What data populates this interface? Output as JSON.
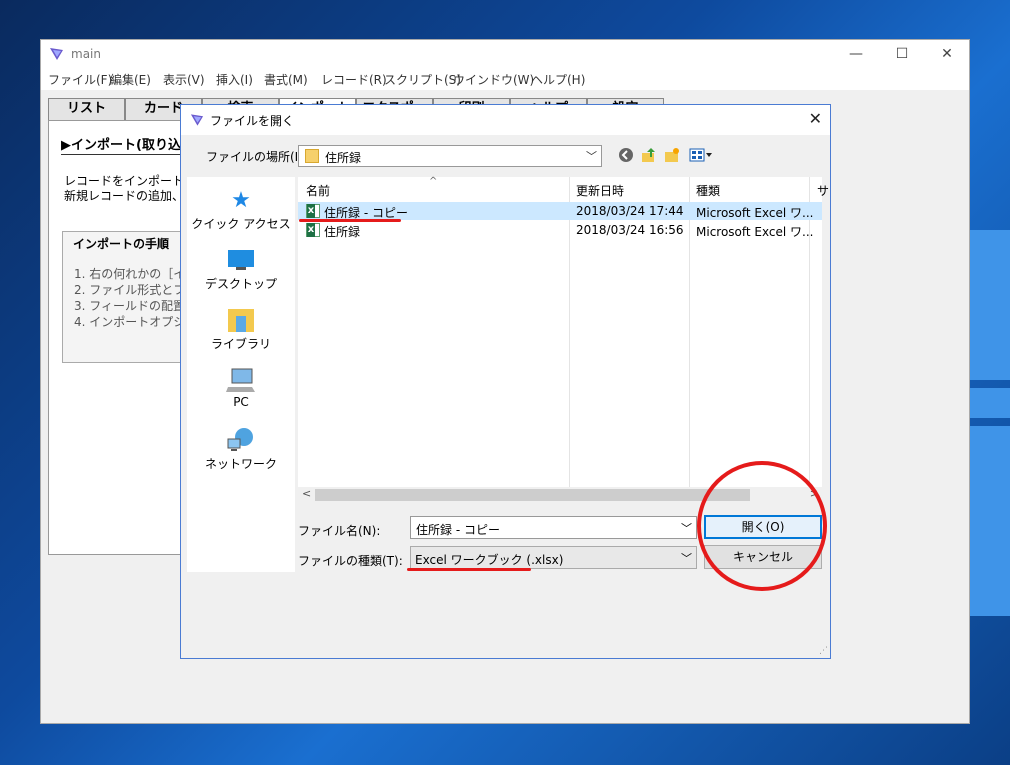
{
  "window": {
    "title": "main",
    "controls": {
      "minimize": "—",
      "maximize": "☐",
      "close": "✕"
    }
  },
  "menubar": [
    "ファイル(F)",
    "編集(E)",
    "表示(V)",
    "挿入(I)",
    "書式(M)",
    "レコード(R)",
    "スクリプト(S)",
    "ウインドウ(W)",
    "ヘルプ(H)"
  ],
  "tabs": [
    "リスト",
    "カード",
    "検索",
    "インポート",
    "エクスポート",
    "印刷",
    "ヘルプ",
    "設定"
  ],
  "content": {
    "heading": "▶インポート(取り込み",
    "line1": "レコードをインポート。",
    "line2": "新規レコードの追加、対",
    "steps_title": "インポートの手順",
    "steps": [
      "1. 右の何れかの［イ",
      "2. ファイル形式とファ",
      "3. フィールドの配置",
      "4. インポートオプショ"
    ]
  },
  "dialog": {
    "title": "ファイルを開く",
    "close": "✕",
    "location_label": "ファイルの場所(I):",
    "location_value": "住所録",
    "places": [
      "クイック アクセス",
      "デスクトップ",
      "ライブラリ",
      "PC",
      "ネットワーク"
    ],
    "columns": [
      "名前",
      "更新日時",
      "種類",
      "サ"
    ],
    "files": [
      {
        "name": "住所録 - コピー",
        "date": "2018/03/24 17:44",
        "type": "Microsoft Excel ワ...",
        "selected": true
      },
      {
        "name": "住所録",
        "date": "2018/03/24 16:56",
        "type": "Microsoft Excel ワ...",
        "selected": false
      }
    ],
    "filename_label": "ファイル名(N):",
    "filename_value": "住所録 - コピー",
    "filetype_label": "ファイルの種類(T):",
    "filetype_value": "Excel ワークブック (.xlsx)",
    "open_label": "開く(O)",
    "cancel_label": "キャンセル"
  },
  "colors": {
    "annotation": "#e51b1b",
    "selection": "#cce8ff",
    "accent": "#0078d7"
  }
}
